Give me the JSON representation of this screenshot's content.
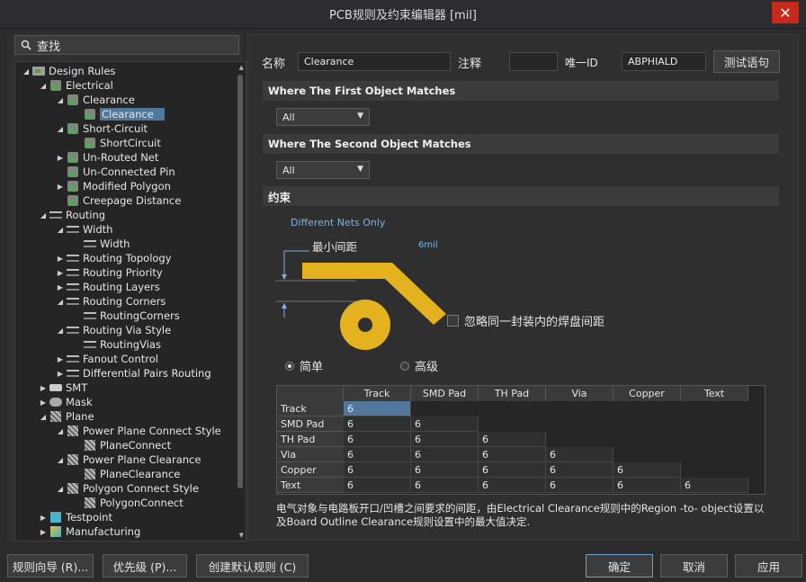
{
  "window": {
    "title": "PCB规则及约束编辑器 [mil]",
    "close_glyph": "✕"
  },
  "left": {
    "search_label": "查找",
    "tree": [
      {
        "label": "Design Rules",
        "depth": 0,
        "expanded": true,
        "icon": "folder-icon"
      },
      {
        "label": "Electrical",
        "depth": 1,
        "expanded": true,
        "icon": "rule-icon"
      },
      {
        "label": "Clearance",
        "depth": 2,
        "expanded": true,
        "icon": "rule-icon"
      },
      {
        "label": "Clearance",
        "depth": 3,
        "expanded": null,
        "icon": "rule-icon",
        "selected": true
      },
      {
        "label": "Short-Circuit",
        "depth": 2,
        "expanded": true,
        "icon": "rule-icon"
      },
      {
        "label": "ShortCircuit",
        "depth": 3,
        "expanded": null,
        "icon": "rule-icon"
      },
      {
        "label": "Un-Routed Net",
        "depth": 2,
        "expanded": false,
        "icon": "rule-icon"
      },
      {
        "label": "Un-Connected Pin",
        "depth": 2,
        "expanded": null,
        "icon": "rule-icon"
      },
      {
        "label": "Modified Polygon",
        "depth": 2,
        "expanded": false,
        "icon": "rule-icon"
      },
      {
        "label": "Creepage Distance",
        "depth": 2,
        "expanded": null,
        "icon": "rule-icon"
      },
      {
        "label": "Routing",
        "depth": 1,
        "expanded": true,
        "icon": "route-icon"
      },
      {
        "label": "Width",
        "depth": 2,
        "expanded": true,
        "icon": "route-icon"
      },
      {
        "label": "Width",
        "depth": 3,
        "expanded": null,
        "icon": "route-icon"
      },
      {
        "label": "Routing Topology",
        "depth": 2,
        "expanded": false,
        "icon": "route-icon"
      },
      {
        "label": "Routing Priority",
        "depth": 2,
        "expanded": false,
        "icon": "route-icon"
      },
      {
        "label": "Routing Layers",
        "depth": 2,
        "expanded": false,
        "icon": "route-icon"
      },
      {
        "label": "Routing Corners",
        "depth": 2,
        "expanded": true,
        "icon": "route-icon"
      },
      {
        "label": "RoutingCorners",
        "depth": 3,
        "expanded": null,
        "icon": "route-icon"
      },
      {
        "label": "Routing Via Style",
        "depth": 2,
        "expanded": true,
        "icon": "route-icon"
      },
      {
        "label": "RoutingVias",
        "depth": 3,
        "expanded": null,
        "icon": "route-icon"
      },
      {
        "label": "Fanout Control",
        "depth": 2,
        "expanded": false,
        "icon": "route-icon"
      },
      {
        "label": "Differential Pairs Routing",
        "depth": 2,
        "expanded": false,
        "icon": "route-icon"
      },
      {
        "label": "SMT",
        "depth": 1,
        "expanded": false,
        "icon": "smt-icon"
      },
      {
        "label": "Mask",
        "depth": 1,
        "expanded": false,
        "icon": "mask-icon"
      },
      {
        "label": "Plane",
        "depth": 1,
        "expanded": true,
        "icon": "plane-icon"
      },
      {
        "label": "Power Plane Connect Style",
        "depth": 2,
        "expanded": true,
        "icon": "plane-icon"
      },
      {
        "label": "PlaneConnect",
        "depth": 3,
        "expanded": null,
        "icon": "plane-icon"
      },
      {
        "label": "Power Plane Clearance",
        "depth": 2,
        "expanded": true,
        "icon": "plane-icon"
      },
      {
        "label": "PlaneClearance",
        "depth": 3,
        "expanded": null,
        "icon": "plane-icon"
      },
      {
        "label": "Polygon Connect Style",
        "depth": 2,
        "expanded": true,
        "icon": "plane-icon"
      },
      {
        "label": "PolygonConnect",
        "depth": 3,
        "expanded": null,
        "icon": "plane-icon"
      },
      {
        "label": "Testpoint",
        "depth": 1,
        "expanded": false,
        "icon": "test-icon"
      },
      {
        "label": "Manufacturing",
        "depth": 1,
        "expanded": false,
        "icon": "manu-icon"
      }
    ]
  },
  "right": {
    "name_label": "名称",
    "name_value": "Clearance",
    "comment_label": "注释",
    "comment_value": "",
    "uid_label": "唯一ID",
    "uid_value": "ABPHIALD",
    "test_button": "测试语句",
    "first_match": "Where The First Object Matches",
    "first_dropdown": "All",
    "second_match": "Where The Second Object Matches",
    "second_dropdown": "All",
    "constraints": "约束",
    "diff_nets": "Different Nets Only",
    "min_clearance": "最小间距",
    "min_value": "6mil",
    "ignore_pad": "忽略同一封装内的焊盘间距",
    "simple": "简单",
    "advanced": "高级",
    "matrix_cols": [
      "Track",
      "SMD Pad",
      "TH Pad",
      "Via",
      "Copper",
      "Text"
    ],
    "matrix_rows": [
      {
        "name": "Track",
        "values": [
          "6"
        ]
      },
      {
        "name": "SMD Pad",
        "values": [
          "6",
          "6"
        ]
      },
      {
        "name": "TH Pad",
        "values": [
          "6",
          "6",
          "6"
        ]
      },
      {
        "name": "Via",
        "values": [
          "6",
          "6",
          "6",
          "6"
        ]
      },
      {
        "name": "Copper",
        "values": [
          "6",
          "6",
          "6",
          "6",
          "6"
        ]
      },
      {
        "name": "Text",
        "values": [
          "6",
          "6",
          "6",
          "6",
          "6",
          "6"
        ]
      }
    ],
    "note": "电气对象与电路板开口/凹槽之间要求的间距，由Electrical Clearance规则中的Region -to- object设置以及Board Outline Clearance规则设置中的最大值决定."
  },
  "buttons": {
    "wizard": "规则向导 (R)...",
    "priority": "优先级 (P)...",
    "default_rules": "创建默认规则 (C)",
    "ok": "确定",
    "cancel": "取消",
    "apply": "应用"
  },
  "colors": {
    "selection": "#51779c",
    "track": "#e5b21f",
    "close": "#c7291b"
  }
}
